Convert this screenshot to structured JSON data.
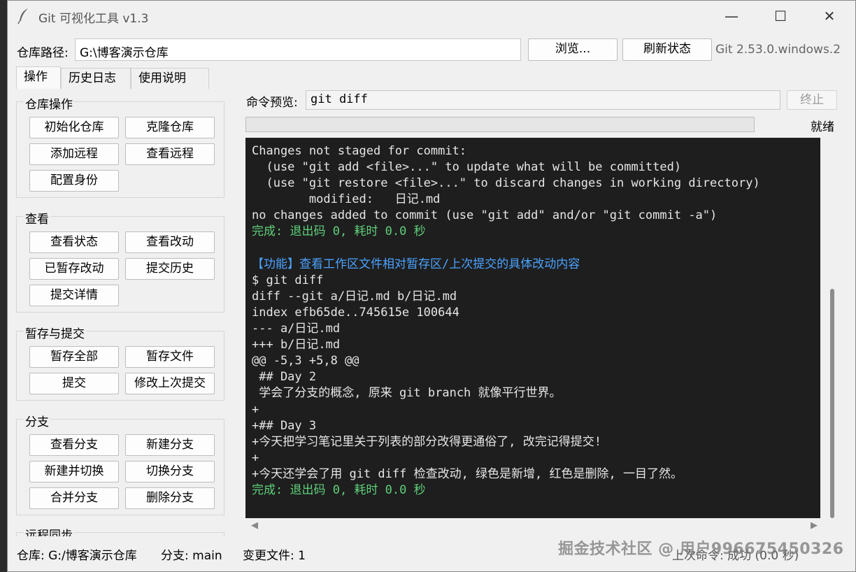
{
  "window": {
    "title": "Git 可视化工具 v1.3",
    "min_glyph": "—",
    "max_glyph": "☐",
    "close_glyph": "✕"
  },
  "path": {
    "label": "仓库路径:",
    "value": "G:\\博客演示仓库",
    "browse_label": "浏览...",
    "refresh_label": "刷新状态",
    "git_version": "Git 2.53.0.windows.2"
  },
  "tabs": [
    {
      "label": "操作",
      "active": true
    },
    {
      "label": "历史日志",
      "active": false
    },
    {
      "label": "使用说明",
      "active": false
    }
  ],
  "groups": {
    "repo": {
      "title": "仓库操作",
      "buttons": [
        "初始化仓库",
        "克隆仓库",
        "添加远程",
        "查看远程",
        "配置身份"
      ]
    },
    "view": {
      "title": "查看",
      "buttons": [
        "查看状态",
        "查看改动",
        "已暂存改动",
        "提交历史",
        "提交详情"
      ]
    },
    "stage": {
      "title": "暂存与提交",
      "buttons": [
        "暂存全部",
        "暂存文件",
        "提交",
        "修改上次提交"
      ]
    },
    "branch": {
      "title": "分支",
      "buttons": [
        "查看分支",
        "新建分支",
        "新建并切换",
        "切换分支",
        "合并分支",
        "删除分支"
      ]
    },
    "remote": {
      "title": "远程同步"
    }
  },
  "command": {
    "label": "命令预览:",
    "value": "git diff",
    "stop_label": "终止"
  },
  "progress": {
    "fraction": 0,
    "status": "就绪"
  },
  "console_lines": [
    {
      "text": "Changes not staged for commit:",
      "type": "normal"
    },
    {
      "text": "  (use \"git add <file>...\" to update what will be committed)",
      "type": "normal"
    },
    {
      "text": "  (use \"git restore <file>...\" to discard changes in working directory)",
      "type": "normal"
    },
    {
      "text": "        modified:   日记.md",
      "type": "normal"
    },
    {
      "text": "no changes added to commit (use \"git add\" and/or \"git commit -a\")",
      "type": "normal"
    },
    {
      "text": "完成: 退出码 0, 耗时 0.0 秒",
      "type": "ok"
    },
    {
      "text": "",
      "type": "normal"
    },
    {
      "text": "【功能】查看工作区文件相对暂存区/上次提交的具体改动内容",
      "type": "func"
    },
    {
      "text": "$ git diff",
      "type": "normal"
    },
    {
      "text": "diff --git a/日记.md b/日记.md",
      "type": "normal"
    },
    {
      "text": "index efb65de..745615e 100644",
      "type": "normal"
    },
    {
      "text": "--- a/日记.md",
      "type": "normal"
    },
    {
      "text": "+++ b/日记.md",
      "type": "normal"
    },
    {
      "text": "@@ -5,3 +5,8 @@",
      "type": "normal"
    },
    {
      "text": " ## Day 2",
      "type": "normal"
    },
    {
      "text": " 学会了分支的概念, 原来 git branch 就像平行世界。",
      "type": "normal"
    },
    {
      "text": "+",
      "type": "normal"
    },
    {
      "text": "+## Day 3",
      "type": "normal"
    },
    {
      "text": "+今天把学习笔记里关于列表的部分改得更通俗了, 改完记得提交!",
      "type": "normal"
    },
    {
      "text": "+",
      "type": "normal"
    },
    {
      "text": "+今天还学会了用 git diff 检查改动, 绿色是新增, 红色是删除, 一目了然。",
      "type": "normal"
    },
    {
      "text": "完成: 退出码 0, 耗时 0.0 秒",
      "type": "ok"
    }
  ],
  "statusbar": {
    "repo": "仓库: G:/博客演示仓库",
    "branch": "分支: main",
    "changes": "变更文件: 1",
    "last": "上次命令: 成功 (0.0 秒)"
  },
  "watermark": "掘金技术社区 @ 用户996675450326",
  "colors": {
    "console_bg": "#1e1e1e",
    "console_text": "#e6e6e6",
    "success": "#5fd07a",
    "function_heading": "#4aa3ff"
  }
}
